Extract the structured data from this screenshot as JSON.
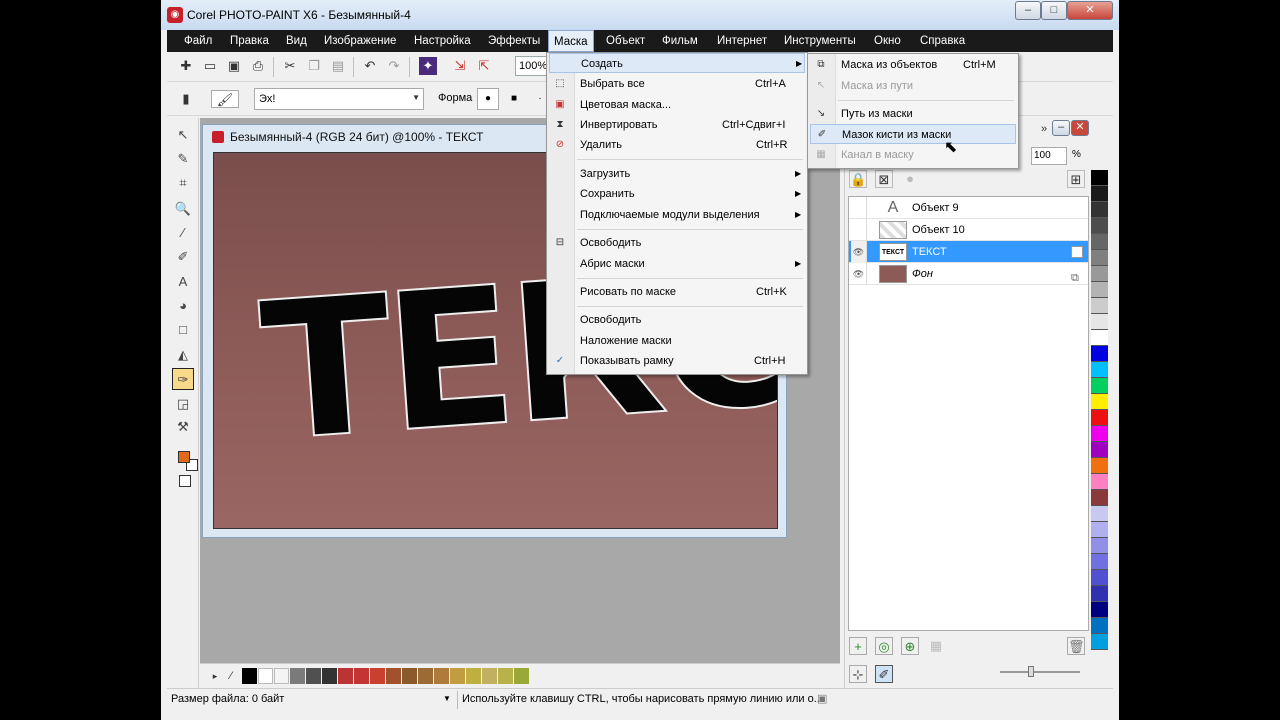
{
  "window": {
    "title": "Corel PHOTO-PAINT X6 - Безымянный-4",
    "icon": "app-icon",
    "controls": [
      "minimize",
      "maximize",
      "close"
    ]
  },
  "menubar": {
    "items": [
      "Файл",
      "Правка",
      "Вид",
      "Изображение",
      "Настройка",
      "Эффекты",
      "Маска",
      "Объект",
      "Фильм",
      "Интернет",
      "Инструменты",
      "Окно",
      "Справка"
    ],
    "active": "Маска"
  },
  "toolbar": {
    "zoom_value": "100%",
    "brush_value": "Эх!",
    "form_label": "Форма"
  },
  "document": {
    "title": "Безымянный-4 (RGB 24 бит) @100% - ТЕКСТ",
    "canvas_text": "ТЕКСТ",
    "canvas_color": "#8c5a57"
  },
  "mask_menu": {
    "items": [
      {
        "label": "Создать",
        "shortcut": "",
        "submenu": true,
        "highlighted": true
      },
      {
        "label": "Выбрать все",
        "shortcut": "Ctrl+A"
      },
      {
        "label": "Цветовая маска...",
        "shortcut": ""
      },
      {
        "label": "Инвертировать",
        "shortcut": "Ctrl+Сдвиг+I"
      },
      {
        "label": "Удалить",
        "shortcut": "Ctrl+R"
      },
      {
        "label": "Загрузить",
        "shortcut": "",
        "submenu": true
      },
      {
        "label": "Сохранить",
        "shortcut": "",
        "submenu": true
      },
      {
        "label": "Подключаемые модули выделения",
        "shortcut": "",
        "submenu": true
      },
      {
        "label": "Освободить",
        "shortcut": ""
      },
      {
        "label": "Абрис маски",
        "shortcut": "",
        "submenu": true
      },
      {
        "label": "Рисовать по маске",
        "shortcut": "Ctrl+K"
      },
      {
        "label": "Освободить",
        "shortcut": ""
      },
      {
        "label": "Наложение маски",
        "shortcut": ""
      },
      {
        "label": "Показывать рамку",
        "shortcut": "Ctrl+H",
        "checked": true
      }
    ]
  },
  "create_submenu": {
    "items": [
      {
        "label": "Маска из объектов",
        "shortcut": "Ctrl+M",
        "disabled": false
      },
      {
        "label": "Маска из пути",
        "shortcut": "",
        "disabled": true
      },
      {
        "label": "Путь из маски",
        "shortcut": "",
        "disabled": false
      },
      {
        "label": "Мазок кисти из маски",
        "shortcut": "",
        "disabled": false,
        "highlighted": true
      },
      {
        "label": "Канал в маску",
        "shortcut": "",
        "disabled": true
      }
    ]
  },
  "objects_panel": {
    "opacity": "100",
    "opacity_unit": "%",
    "objects": [
      {
        "name": "Объект 9",
        "selected": false
      },
      {
        "name": "Объект 10",
        "selected": false
      },
      {
        "name": "ТЕКСТ",
        "selected": true
      },
      {
        "name": "Фон",
        "selected": false
      }
    ]
  },
  "status": {
    "file_size": "Размер файла: 0 байт",
    "hint": "Используйте клавишу CTRL, чтобы нарисовать прямую линию или о..."
  }
}
